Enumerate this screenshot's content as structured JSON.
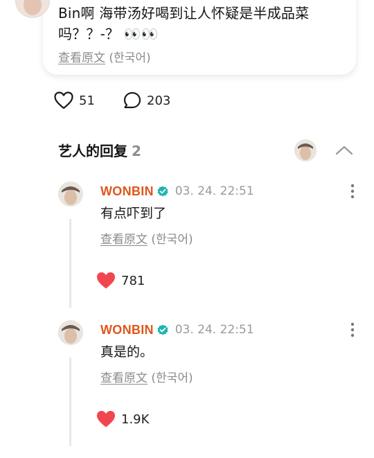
{
  "post": {
    "line1": "Bin啊 海带汤好喝到让人怀疑是半成品菜",
    "line2": "吗？？-？ 👀👀",
    "translate_link": "查看原文",
    "translate_lang": "(한국어)"
  },
  "stats": {
    "likes": "51",
    "comments": "203"
  },
  "artist_replies": {
    "title": "艺人的回复",
    "count": "2"
  },
  "replies": [
    {
      "author": "WONBIN",
      "timestamp": "03. 24. 22:51",
      "text": "有点吓到了",
      "translate_link": "查看原文",
      "translate_lang": "(한국어)",
      "likes": "781"
    },
    {
      "author": "WONBIN",
      "timestamp": "03. 24. 22:51",
      "text": "真是的。",
      "translate_link": "查看原文",
      "translate_lang": "(한국어)",
      "likes": "1.9K"
    }
  ],
  "icons": {
    "heart_outline": "heart-outline-icon",
    "comment": "comment-bubble-icon",
    "heart_filled": "heart-filled-icon",
    "verified": "verified-badge-icon",
    "more": "more-vertical-icon",
    "collapse": "chevron-up-icon"
  },
  "colors": {
    "author": "#e0561c",
    "verified": "#1fb5b0",
    "heart": "#f2464f",
    "muted": "#8a8a8a"
  }
}
